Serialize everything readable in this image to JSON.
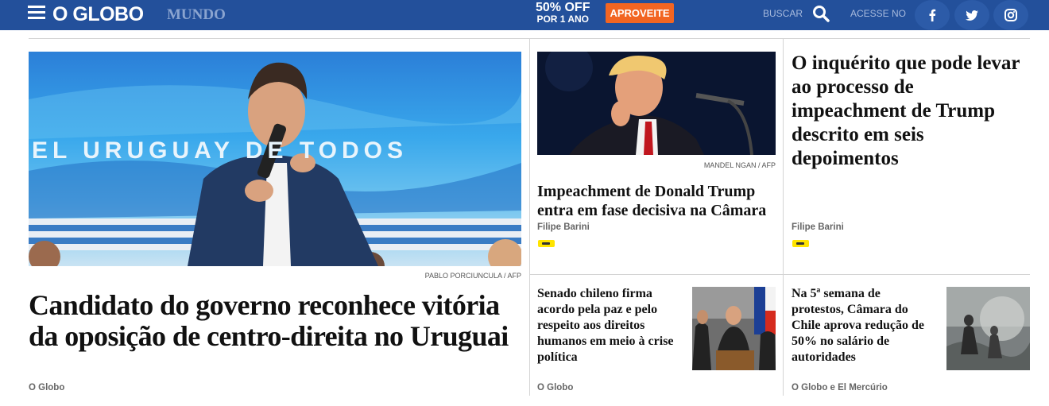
{
  "header": {
    "logo": "O GLOBO",
    "section": "MUNDO",
    "promo_big": "50% OFF",
    "promo_small": "POR 1 ANO",
    "promo_button": "APROVEITE",
    "search_label": "BUSCAR",
    "login_label": "ACESSE NO",
    "social": [
      "f",
      "t",
      "i"
    ],
    "colors": {
      "bar": "#23509b",
      "promo": "#f26522"
    }
  },
  "main_story": {
    "image_text": "EL URUGUAY DE TODOS",
    "credit": "PABLO PORCIUNCULA / AFP",
    "headline": "Candidato do governo reconhece vitória da oposição de centro-direita no Uruguai",
    "author": "O Globo"
  },
  "story_2": {
    "credit": "MANDEL NGAN / AFP",
    "headline": "Impeachment de Donald Trump entra em fase decisiva na Câmara",
    "author": "Filipe Barini"
  },
  "story_3": {
    "headline": "O inquérito que pode levar ao processo de impeachment de Trump descrito em seis depoimentos",
    "author": "Filipe Barini"
  },
  "story_4": {
    "headline": "Senado chileno firma acordo pela paz e pelo respeito aos direitos humanos em meio à crise política",
    "author": "O Globo"
  },
  "story_5": {
    "headline": "Na 5ª semana de protestos, Câmara do Chile aprova redução de 50% no salário de autoridades",
    "author": "O Globo e El Mercúrio"
  }
}
